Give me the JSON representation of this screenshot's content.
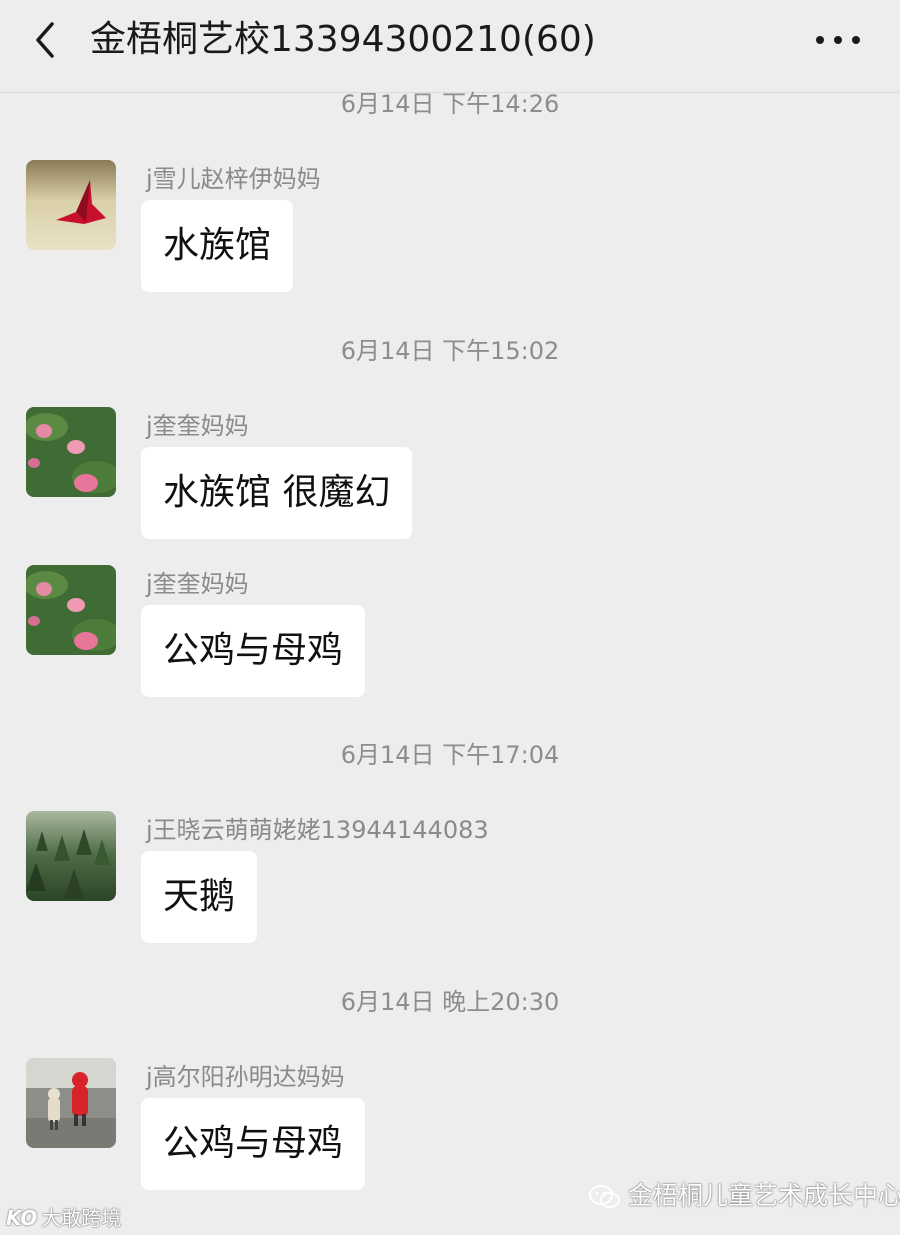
{
  "header": {
    "back_icon": "chevron-left-icon",
    "title": "金梧桐艺校13394300210(60)",
    "more_icon": "more-dots-icon"
  },
  "messages": [
    {
      "timestamp": "6月14日 下午14:26",
      "sender": "j雪儿赵梓伊妈妈",
      "text": "水族馆",
      "avatar": "paper-crane"
    },
    {
      "timestamp": "6月14日 下午15:02",
      "sender": "j奎奎妈妈",
      "text": "水族馆 很魔幻",
      "avatar": "lotus"
    },
    {
      "timestamp": "",
      "sender": "j奎奎妈妈",
      "text": "公鸡与母鸡",
      "avatar": "lotus"
    },
    {
      "timestamp": "6月14日 下午17:04",
      "sender": "j王晓云萌萌姥姥13944144083",
      "text": "天鹅",
      "avatar": "forest"
    },
    {
      "timestamp": "6月14日 晚上20:30",
      "sender": "j高尔阳孙明达妈妈",
      "text": "公鸡与母鸡",
      "avatar": "children"
    }
  ],
  "watermarks": {
    "left_logo": "KO",
    "left_text": "大敢跨境",
    "right_text": "金梧桐儿童艺术成长中心",
    "right_icon": "wechat-icon"
  },
  "colors": {
    "background": "#ededed",
    "bubble": "#ffffff",
    "meta_text": "#8d8d8d"
  }
}
